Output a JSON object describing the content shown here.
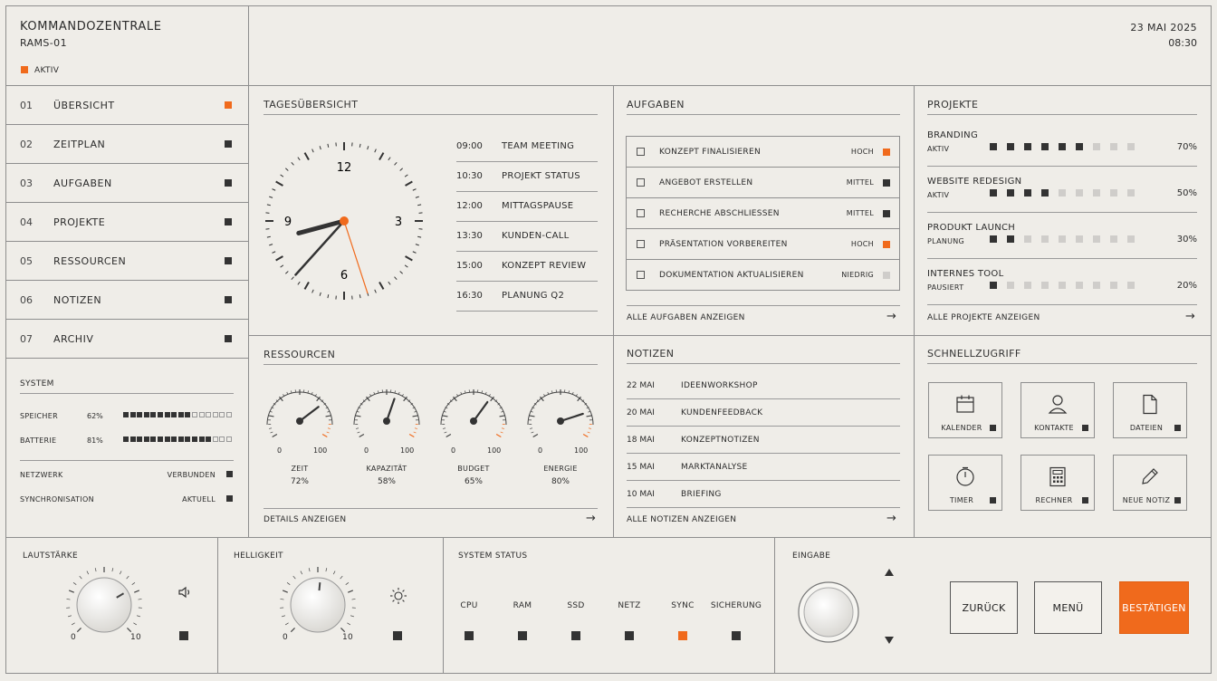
{
  "header": {
    "title": "KOMMANDOZENTRALE",
    "subtitle": "RAMS-01",
    "status": "AKTIV",
    "date": "23 MAI 2025",
    "time": "08:30"
  },
  "nav": [
    {
      "num": "01",
      "label": "ÜBERSICHT",
      "active": true
    },
    {
      "num": "02",
      "label": "ZEITPLAN"
    },
    {
      "num": "03",
      "label": "AUFGABEN"
    },
    {
      "num": "04",
      "label": "PROJEKTE"
    },
    {
      "num": "05",
      "label": "RESSOURCEN"
    },
    {
      "num": "06",
      "label": "NOTIZEN"
    },
    {
      "num": "07",
      "label": "ARCHIV"
    }
  ],
  "system": {
    "title": "SYSTEM",
    "memory": {
      "label": "SPEICHER",
      "value": "62%",
      "level": 0.62
    },
    "battery": {
      "label": "BATTERIE",
      "value": "81%",
      "level": 0.81
    },
    "network": {
      "label": "NETZWERK",
      "value": "VERBUNDEN"
    },
    "sync": {
      "label": "SYNCHRONISATION",
      "value": "AKTUELL"
    }
  },
  "overview": {
    "title": "TAGESÜBERSICHT",
    "clock": {
      "n12": "12",
      "n3": "3",
      "n6": "6",
      "n9": "9",
      "hour": 8,
      "minute": 30,
      "second": 32
    },
    "schedule": [
      {
        "time": "09:00",
        "event": "TEAM MEETING"
      },
      {
        "time": "10:30",
        "event": "PROJEKT STATUS"
      },
      {
        "time": "12:00",
        "event": "MITTAGSPAUSE"
      },
      {
        "time": "13:30",
        "event": "KUNDEN-CALL"
      },
      {
        "time": "15:00",
        "event": "KONZEPT REVIEW"
      },
      {
        "time": "16:30",
        "event": "PLANUNG Q2"
      }
    ]
  },
  "tasks": {
    "title": "AUFGABEN",
    "items": [
      {
        "label": "KONZEPT FINALISIEREN",
        "priority": "HOCH",
        "color": "orange"
      },
      {
        "label": "ANGEBOT ERSTELLEN",
        "priority": "MITTEL",
        "color": "dark"
      },
      {
        "label": "RECHERCHE ABSCHLIESSEN",
        "priority": "MITTEL",
        "color": "dark"
      },
      {
        "label": "PRÄSENTATION VORBEREITEN",
        "priority": "HOCH",
        "color": "orange"
      },
      {
        "label": "DOKUMENTATION AKTUALISIEREN",
        "priority": "NIEDRIG",
        "color": "light"
      }
    ],
    "link": "ALLE AUFGABEN ANZEIGEN"
  },
  "projects": {
    "title": "PROJEKTE",
    "items": [
      {
        "name": "BRANDING",
        "status": "AKTIV",
        "pct": "70%",
        "filled": 6
      },
      {
        "name": "WEBSITE REDESIGN",
        "status": "AKTIV",
        "pct": "50%",
        "filled": 4
      },
      {
        "name": "PRODUKT LAUNCH",
        "status": "PLANUNG",
        "pct": "30%",
        "filled": 2
      },
      {
        "name": "INTERNES TOOL",
        "status": "PAUSIERT",
        "pct": "20%",
        "filled": 1
      }
    ],
    "link": "ALLE PROJEKTE ANZEIGEN"
  },
  "resources": {
    "title": "RESSOURCEN",
    "min": "0",
    "max": "100",
    "gauges": [
      {
        "label": "ZEIT",
        "value": "72%",
        "level": 72
      },
      {
        "label": "KAPAZITÄT",
        "value": "58%",
        "level": 58
      },
      {
        "label": "BUDGET",
        "value": "65%",
        "level": 65
      },
      {
        "label": "ENERGIE",
        "value": "80%",
        "level": 80
      }
    ],
    "link": "DETAILS ANZEIGEN"
  },
  "notes": {
    "title": "NOTIZEN",
    "items": [
      {
        "date": "22 MAI",
        "text": "IDEENWORKSHOP"
      },
      {
        "date": "20 MAI",
        "text": "KUNDENFEEDBACK"
      },
      {
        "date": "18 MAI",
        "text": "KONZEPTNOTIZEN"
      },
      {
        "date": "15 MAI",
        "text": "MARKTANALYSE"
      },
      {
        "date": "10 MAI",
        "text": "BRIEFING"
      }
    ],
    "link": "ALLE NOTIZEN ANZEIGEN"
  },
  "quick": {
    "title": "SCHNELLZUGRIFF",
    "items": [
      {
        "label": "KALENDER",
        "icon": "calendar-icon"
      },
      {
        "label": "KONTAKTE",
        "icon": "user-icon"
      },
      {
        "label": "DATEIEN",
        "icon": "file-icon"
      },
      {
        "label": "TIMER",
        "icon": "timer-icon"
      },
      {
        "label": "RECHNER",
        "icon": "calculator-icon"
      },
      {
        "label": "NEUE NOTIZ",
        "icon": "pencil-icon"
      }
    ]
  },
  "volume": {
    "title": "LAUTSTÄRKE",
    "min": "0",
    "max": "10",
    "level": 0.72
  },
  "brightness": {
    "title": "HELLIGKEIT",
    "min": "0",
    "max": "10",
    "level": 0.52
  },
  "sysstatus": {
    "title": "SYSTEM STATUS",
    "items": [
      {
        "label": "CPU",
        "color": "dark"
      },
      {
        "label": "RAM",
        "color": "dark"
      },
      {
        "label": "SSD",
        "color": "dark"
      },
      {
        "label": "NETZ",
        "color": "dark"
      },
      {
        "label": "SYNC",
        "color": "orange"
      },
      {
        "label": "SICHERUNG",
        "color": "dark"
      }
    ]
  },
  "input": {
    "title": "EINGABE"
  },
  "buttons": {
    "back": "ZURÜCK",
    "menu": "MENÜ",
    "confirm": "BESTÄTIGEN"
  },
  "colors": {
    "accent": "#f06a1c",
    "dark": "#333333",
    "light": "#cfcdca"
  }
}
